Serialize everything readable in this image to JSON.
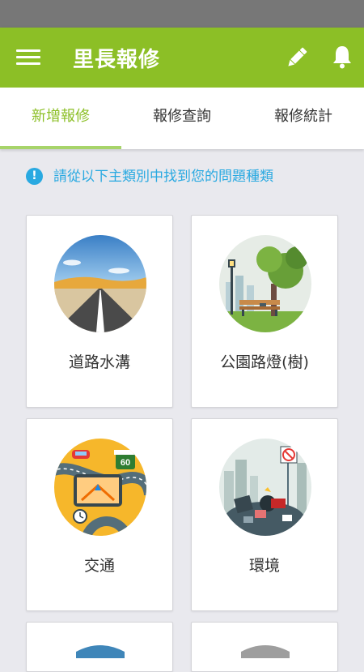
{
  "app_bar": {
    "title": "里長報修"
  },
  "tabs": [
    {
      "label": "新增報修",
      "active": true
    },
    {
      "label": "報修查詢",
      "active": false
    },
    {
      "label": "報修統計",
      "active": false
    }
  ],
  "hint": {
    "text": "請從以下主類別中找到您的問題種類"
  },
  "categories": [
    {
      "label": "道路水溝",
      "icon": "road-icon"
    },
    {
      "label": "公園路燈(樹)",
      "icon": "park-icon"
    },
    {
      "label": "交通",
      "icon": "traffic-icon"
    },
    {
      "label": "環境",
      "icon": "environment-icon"
    }
  ],
  "traffic_sign_number": "60",
  "colors": {
    "app_bar": "#8cbf26",
    "active_tab": "#8cbf26",
    "hint": "#29a9e1",
    "background": "#e9e9ee"
  }
}
